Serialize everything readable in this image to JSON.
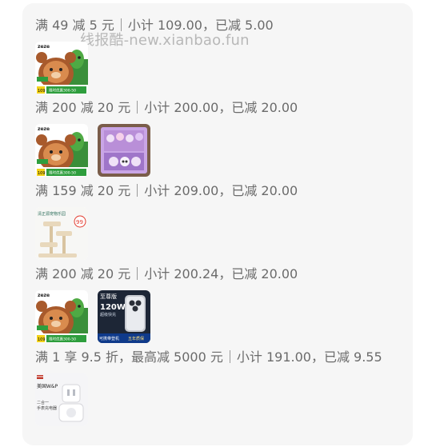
{
  "watermark": "线报酷-new.xianbao.fun",
  "groups": [
    {
      "promo": "满 49 减 5 元",
      "summary": "小计 109.00，已减 5.00",
      "thumbs": [
        {
          "icon": "plush-toy-bear-icon",
          "brand": "zeze",
          "badge": "109",
          "ribbon": "限时优惠300-50"
        }
      ]
    },
    {
      "promo": "满 200 减 20 元",
      "summary": "小计 200.00，已减 20.00",
      "thumbs": [
        {
          "icon": "plush-toy-bear-icon",
          "brand": "zeze",
          "badge": "109",
          "ribbon": "限时优惠300-50"
        },
        {
          "icon": "toy-gift-box-icon"
        }
      ]
    },
    {
      "promo": "满 159 减 20 元",
      "summary": "小计 209.00，已减 20.00",
      "thumbs": [
        {
          "icon": "cat-tree-icon",
          "tag": "清正源宠物乐园",
          "badge": "99"
        }
      ]
    },
    {
      "promo": "满 200 减 20 元",
      "summary": "小计 200.24，已减 20.00",
      "thumbs": [
        {
          "icon": "plush-toy-bear-icon",
          "brand": "zeze",
          "badge": "109",
          "ribbon": "限时优惠300-50"
        },
        {
          "icon": "phone-charger-icon",
          "title": "至尊版",
          "power": "120W",
          "sub": "超级快充",
          "promo": "可携带登机",
          "promo2": "五年质保"
        }
      ]
    },
    {
      "promo": "满 1 享 9.5 折，最高减 5000 元",
      "summary": "小计 191.00，已减 9.55",
      "thumbs": [
        {
          "icon": "charger-adapter-icon",
          "brand": "美国W&P",
          "sub": "二合一",
          "sub2": "手表充电器"
        }
      ]
    }
  ],
  "colors": {
    "card": "#f6f6f6",
    "text": "#6b6b6b",
    "watermark": "#b8b8b8",
    "badge_green": "#2e9e3d",
    "badge_yellow": "#f3d21a",
    "toy_purple": "#b98fd8",
    "charger_dark": "#1d2636"
  }
}
